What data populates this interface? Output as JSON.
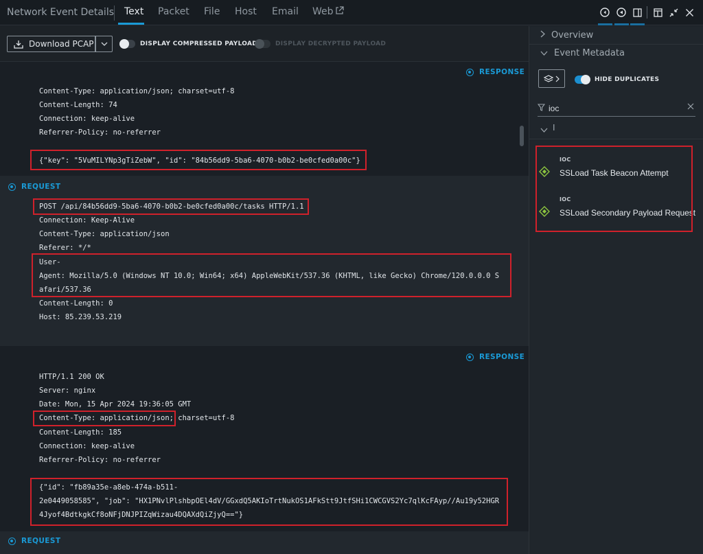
{
  "topbar": {
    "title": "Network Event Details",
    "tabs": [
      "Text",
      "Packet",
      "File",
      "Host",
      "Email",
      "Web"
    ],
    "icons": [
      "arrow-circle-left-icon",
      "arrow-circle-left-filled-icon",
      "panel-icon",
      "window-icon",
      "collapse-icon",
      "close-icon"
    ]
  },
  "toolbar": {
    "download_label": "Download PCAP",
    "compressed_label": "DISPLAY COMPRESSED PAYLOADS",
    "decrypted_label": "DISPLAY DECRYPTED PAYLOAD"
  },
  "content": {
    "response1": {
      "label": "RESPONSE",
      "lines": [
        "Content-Type: application/json; charset=utf-8",
        "Content-Length: 74",
        "Connection: keep-alive",
        "Referrer-Policy: no-referrer"
      ],
      "body": "{\"key\": \"5VuMILYNp3gTiZebW\", \"id\": \"84b56dd9-5ba6-4070-b0b2-be0cfed0a00c\"}"
    },
    "request1": {
      "label": "REQUEST",
      "request_line": "POST /api/84b56dd9-5ba6-4070-b0b2-be0cfed0a00c/tasks HTTP/1.1",
      "lines_a": [
        "Connection: Keep-Alive",
        "Content-Type: application/json",
        "Referer: */*"
      ],
      "ua_lines": [
        "User-",
        "Agent: Mozilla/5.0 (Windows NT 10.0; Win64; x64) AppleWebKit/537.36 (KHTML, like Gecko) Chrome/120.0.0.0 S",
        "afari/537.36"
      ],
      "lines_b": [
        "Content-Length: 0",
        "Host: 85.239.53.219"
      ]
    },
    "response2": {
      "label": "RESPONSE",
      "lines_a": [
        "HTTP/1.1 200 OK",
        "Server: nginx",
        "Date: Mon, 15 Apr 2024 19:36:05 GMT"
      ],
      "ct_part": "Content-Type: application/json;",
      "ct_rest": " charset=utf-8",
      "lines_b": [
        "Content-Length: 185",
        "Connection: keep-alive",
        "Referrer-Policy: no-referrer"
      ],
      "body_lines": [
        "{\"id\": \"fb89a35e-a8eb-474a-b511-",
        "2e0449058585\", \"job\": \"HX1PNvlPlshbpOEl4dV/GGxdQ5AKIoTrtNukOS1AFkStt9JtfSHi1CWCGVS2Yc7qlKcFAyp//Au19y52HGR",
        "4Jyof4BdtkgkCf8oNFjDNJPIZqWizau4DQAXdQiZjyQ==\"}"
      ]
    },
    "request2": {
      "label": "REQUEST"
    }
  },
  "sidebar": {
    "overview_label": "Overview",
    "metadata_label": "Event Metadata",
    "hide_duplicates_label": "HIDE DUPLICATES",
    "filter_value": "ioc",
    "group_label": "I",
    "iocs": [
      {
        "tag": "IOC",
        "name": "SSLoad Task Beacon Attempt"
      },
      {
        "tag": "IOC",
        "name": "SSLoad Secondary Payload Request"
      }
    ]
  },
  "colors": {
    "accent": "#1a9ad6",
    "highlight": "#d0212b",
    "ioc_gem": "#8dc63f"
  }
}
